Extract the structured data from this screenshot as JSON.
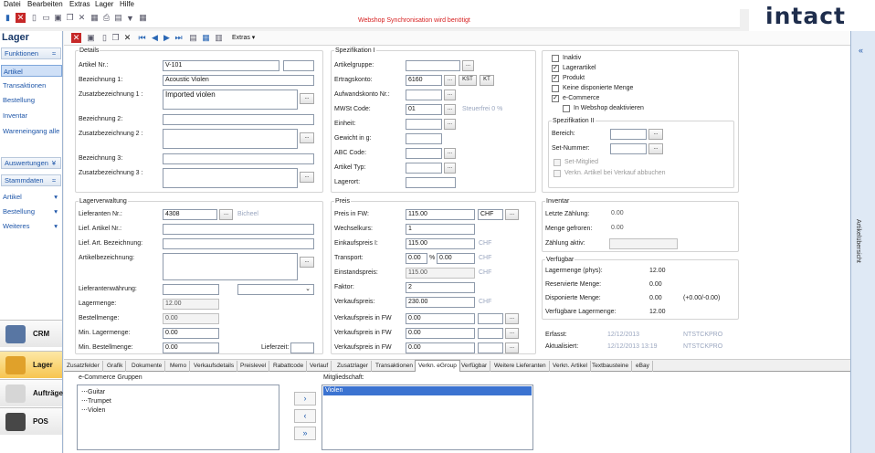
{
  "menu": [
    "Datei",
    "Bearbeiten",
    "Extras",
    "Lager",
    "Hilfe"
  ],
  "banner": "Webshop Synchronisation wird benötigt",
  "brand": "intact",
  "sidebar": {
    "title": "Lager",
    "funktionen": "Funktionen",
    "func_items": [
      "Artikel",
      "Transaktionen",
      "Bestellung",
      "Inventar",
      "Wareneingang alle"
    ],
    "auswertungen": "Auswertungen",
    "stammdaten": "Stammdaten",
    "stamm_items": [
      "Artikel",
      "Bestellung",
      "Weiteres"
    ],
    "nav": [
      "CRM",
      "Lager",
      "Aufträge",
      "POS"
    ]
  },
  "toolbar2": {
    "extras": "Extras"
  },
  "right_strip": "Artikelübersicht",
  "details": {
    "title": "Details",
    "artikel_nr_label": "Artikel Nr.:",
    "artikel_nr": "V-101",
    "bez1_label": "Bezeichnung 1:",
    "bez1": "Acoustic Violen",
    "zbez1_label": "Zusatzbezeichnung 1 :",
    "zbez1": "Imported violen",
    "bez2_label": "Bezeichnung 2:",
    "zbez2_label": "Zusatzbezeichnung 2 :",
    "bez3_label": "Bezeichnung 3:",
    "zbez3_label": "Zusatzbezeichnung 3 :"
  },
  "spez1": {
    "title": "Spezifikation I",
    "artikelgruppe_label": "Artikelgruppe:",
    "ertragskonto_label": "Ertragskonto:",
    "ertragskonto": "6160",
    "kst": "KST",
    "kt": "KT",
    "aufwand_label": "Aufwandskonto Nr.:",
    "mwst_label": "MWSt Code:",
    "mwst": "01",
    "steuerfrei": "Steuerfrei 0 %",
    "einheit_label": "Einheit:",
    "gewicht_label": "Gewicht in g:",
    "abc_label": "ABC Code:",
    "typ_label": "Artikel Typ:",
    "lagerort_label": "Lagerort:"
  },
  "flags": {
    "inaktiv": "Inaktiv",
    "lagerartikel": "Lagerartikel",
    "produkt": "Produkt",
    "keine_dispo": "Keine disponierte Menge",
    "ecommerce": "e-Commerce",
    "webshop_deakt": "In Webshop deaktivieren"
  },
  "spez2": {
    "title": "Spezifikation II",
    "bereich_label": "Bereich:",
    "set_nummer_label": "Set-Nummer:",
    "set_mitglied": "Set-Mitglied",
    "verkn_abbuchen": "Verkn. Artikel bei Verkauf abbuchen"
  },
  "lager": {
    "title": "Lagerverwaltung",
    "lieferanten_label": "Lieferanten Nr.:",
    "lieferanten": "4308",
    "lieferant_name": "Bicheel",
    "lief_art_label": "Lief. Artikel Nr.:",
    "lief_art_bez_label": "Lief. Art. Bezeichnung:",
    "artikelbez_label": "Artikelbezeichnung:",
    "lief_waehrung_label": "Lieferantenwährung:",
    "lagermenge_label": "Lagermenge:",
    "lagermenge": "12.00",
    "bestellmenge_label": "Bestellmenge:",
    "bestellmenge": "0.00",
    "min_lager_label": "Min. Lagermenge:",
    "min_lager": "0.00",
    "min_bestell_label": "Min. Bestellmenge:",
    "min_bestell": "0.00",
    "lieferzeit_label": "Lieferzeit:"
  },
  "preis": {
    "title": "Preis",
    "preis_fw_label": "Preis in FW:",
    "preis_fw": "115.00",
    "currency": "CHF",
    "wechselkurs_label": "Wechselkurs:",
    "wechselkurs": "1",
    "einkauf_label": "Einkaufspreis I:",
    "einkauf": "115.00",
    "transport_label": "Transport:",
    "transport_pct": "0.00",
    "pct": "%",
    "transport_val": "0.00",
    "einstand_label": "Einstandspreis:",
    "einstand": "115.00",
    "faktor_label": "Faktor:",
    "faktor": "2",
    "verkauf_label": "Verkaufspreis:",
    "verkauf": "230.00",
    "vk_fw_label": "Verkaufspreis in FW",
    "vk_fw": [
      "0.00",
      "0.00",
      "0.00"
    ]
  },
  "inventar": {
    "title": "Inventar",
    "letzte_label": "Letzte Zählung:",
    "letzte": "0.00",
    "gefroren_label": "Menge gefroren:",
    "gefroren": "0.00",
    "aktiv_label": "Zählung aktiv:"
  },
  "verfuegbar": {
    "title": "Verfügbar",
    "phys_label": "Lagermenge (phys):",
    "phys": "12.00",
    "reserviert_label": "Reservierte Menge:",
    "reserviert": "0.00",
    "dispo_label": "Disponierte Menge:",
    "dispo": "0.00",
    "dispo_extra": "(+0.00/-0.00)",
    "verf_label": "Verfügbare Lagermenge:",
    "verf": "12.00"
  },
  "audit": {
    "erfasst_label": "Erfasst:",
    "erfasst_date": "12/12/2013",
    "erfasst_user": "NTSTCKPRO",
    "aktual_label": "Aktualisiert:",
    "aktual_date": "12/12/2013 13:19",
    "aktual_user": "NTSTCKPRO"
  },
  "tabs": [
    "Zusatzfelder",
    "Grafik",
    "Dokumente",
    "Memo",
    "Verkaufsdetails",
    "Preislevel",
    "Rabattcode",
    "Verlauf",
    "Zusatzlager",
    "Transaktionen",
    "Verkn. eGroup",
    "Verfügbar",
    "Weitere Lieferanten",
    "Verkn. Artikel",
    "Textbausteine",
    "eBay"
  ],
  "egroup": {
    "gruppen_label": "e-Commerce Gruppen",
    "gruppen": [
      "Guitar",
      "Trumpet",
      "Violen"
    ],
    "mitglied_label": "Mitgliedschaft:",
    "mitglied": [
      "Violen"
    ]
  }
}
